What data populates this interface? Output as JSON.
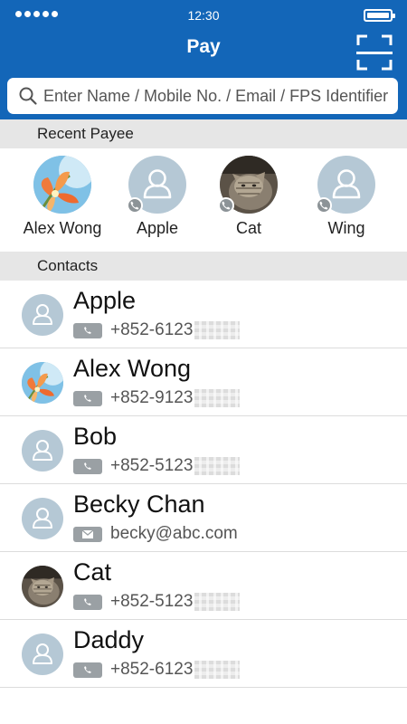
{
  "status_bar": {
    "time": "12:30"
  },
  "header": {
    "title": "Pay",
    "scan_icon": "qr-scan-icon"
  },
  "search": {
    "placeholder": "Enter Name / Mobile No. / Email / FPS Identifier",
    "icon": "search-icon"
  },
  "recent": {
    "header": "Recent Payee",
    "payees": [
      {
        "name": "Alex Wong",
        "avatar": "photo-flower"
      },
      {
        "name": "Apple",
        "avatar": "default-person",
        "badge": "phone-icon"
      },
      {
        "name": "Cat",
        "avatar": "photo-cat",
        "badge": "phone-icon"
      },
      {
        "name": "Wing",
        "avatar": "default-person",
        "badge": "phone-icon"
      }
    ]
  },
  "contacts": {
    "header": "Contacts",
    "items": [
      {
        "name": "Apple",
        "type": "phone",
        "value": "+852-6123",
        "avatar": "default-person",
        "masked": true
      },
      {
        "name": "Alex Wong",
        "type": "phone",
        "value": "+852-9123",
        "avatar": "photo-flower",
        "masked": true
      },
      {
        "name": "Bob",
        "type": "phone",
        "value": "+852-5123",
        "avatar": "default-person",
        "masked": true
      },
      {
        "name": "Becky Chan",
        "type": "email",
        "value": "becky@abc.com",
        "avatar": "default-person",
        "masked": false
      },
      {
        "name": "Cat",
        "type": "phone",
        "value": "+852-5123",
        "avatar": "photo-cat",
        "masked": true
      },
      {
        "name": "Daddy",
        "type": "phone",
        "value": "+852-6123",
        "avatar": "default-person",
        "masked": true
      }
    ]
  },
  "colors": {
    "header_bg": "#1366b8",
    "section_bg": "#e6e6e6",
    "avatar_bg": "#b5c8d5",
    "tag_bg": "#9aa0a4"
  }
}
